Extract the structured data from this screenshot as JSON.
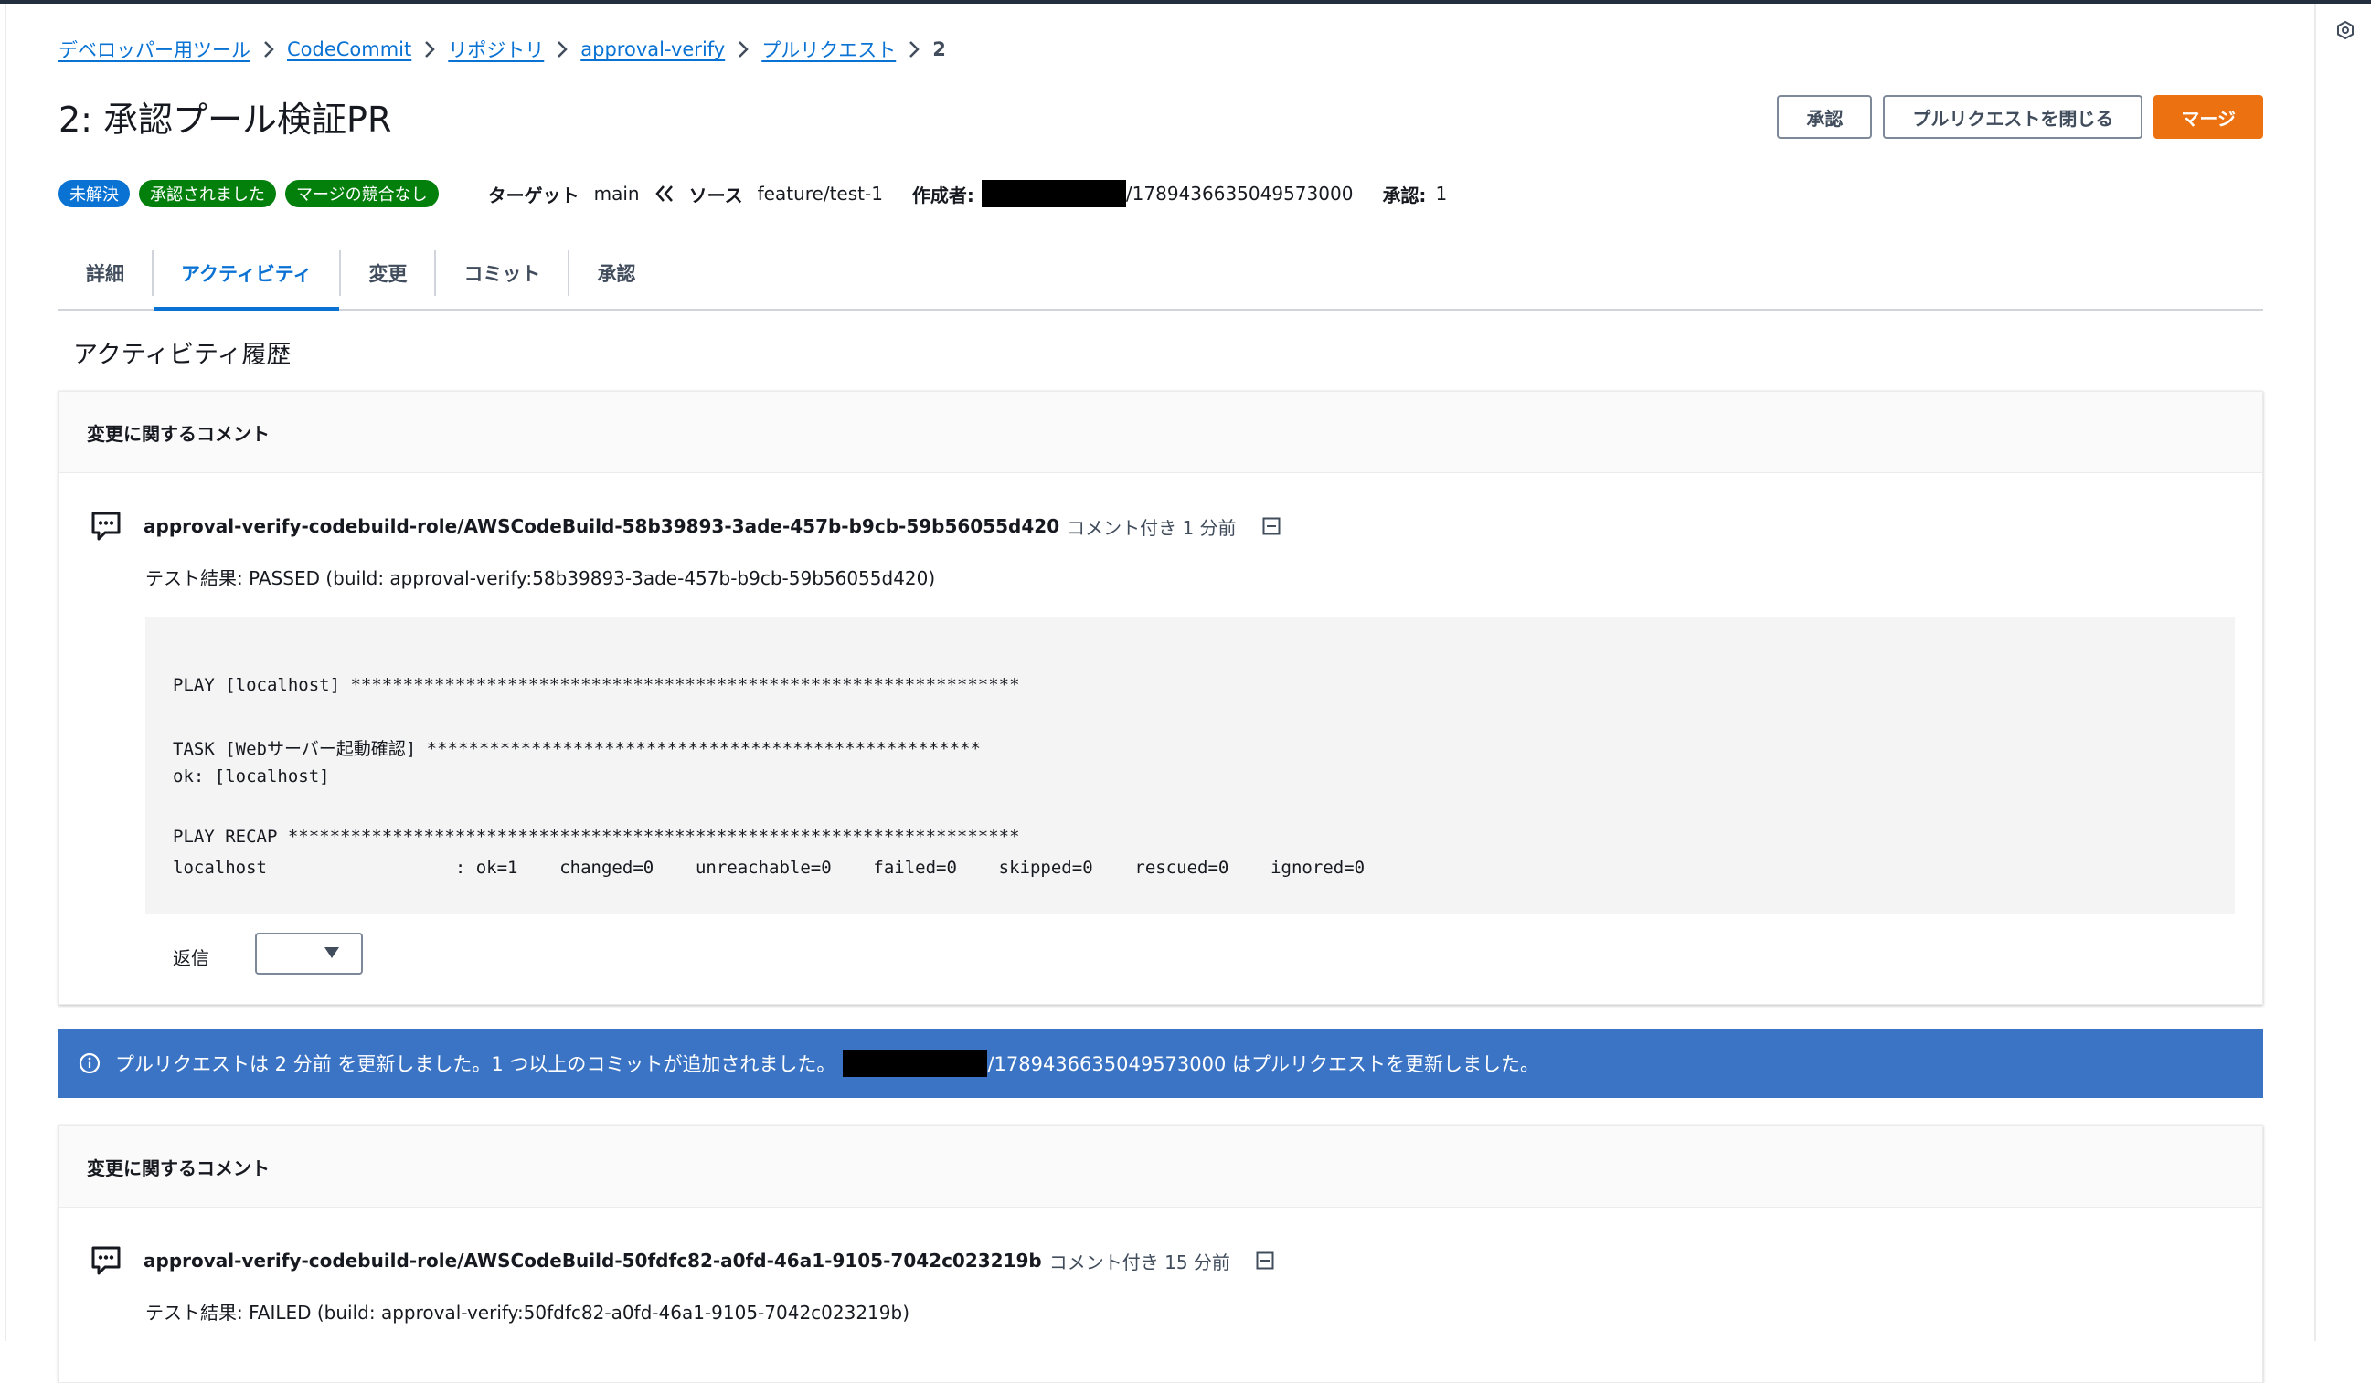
{
  "breadcrumb": {
    "items": [
      "デベロッパー用ツール",
      "CodeCommit",
      "リポジトリ",
      "approval-verify",
      "プルリクエスト"
    ],
    "current": "2"
  },
  "page": {
    "title": "2: 承認プール検証PR"
  },
  "actions": {
    "approve_label": "承認",
    "close_label": "プルリクエストを閉じる",
    "merge_label": "マージ"
  },
  "status": {
    "badges": [
      "未解決",
      "承認されました",
      "マージの競合なし"
    ],
    "target_label": "ターゲット",
    "target_value": "main",
    "source_label": "ソース",
    "source_value": "feature/test-1",
    "author_label": "作成者:",
    "author_suffix": "/1789436635049573000",
    "approvals_label": "承認:",
    "approvals_value": "1"
  },
  "tabs": [
    "詳細",
    "アクティビティ",
    "変更",
    "コミット",
    "承認"
  ],
  "activity": {
    "section_title": "アクティビティ履歴"
  },
  "comment1": {
    "header": "変更に関するコメント",
    "author": "approval-verify-codebuild-role/AWSCodeBuild-58b39893-3ade-457b-b9cb-59b56055d420",
    "meta": "コメント付き 1 分前",
    "result": "テスト結果: PASSED (build: approval-verify:58b39893-3ade-457b-b9cb-59b56055d420)",
    "code": [
      "PLAY [localhost] ****************************************************************",
      "TASK [Webサーバー起動確認] *****************************************************",
      "ok: [localhost]",
      "PLAY RECAP **********************************************************************",
      "localhost                  : ok=1    changed=0    unreachable=0    failed=0    skipped=0    rescued=0    ignored=0"
    ],
    "reply_label": "返信"
  },
  "info": {
    "text_before": "プルリクエストは 2 分前 を更新しました。1 つ以上のコミットが追加されました。",
    "text_after": "/1789436635049573000 はプルリクエストを更新しました。"
  },
  "comment2": {
    "header": "変更に関するコメント",
    "author": "approval-verify-codebuild-role/AWSCodeBuild-50fdfc82-a0fd-46a1-9105-7042c023219b",
    "meta": "コメント付き 15 分前",
    "result": "テスト結果: FAILED (build: approval-verify:50fdfc82-a0fd-46a1-9105-7042c023219b)"
  }
}
